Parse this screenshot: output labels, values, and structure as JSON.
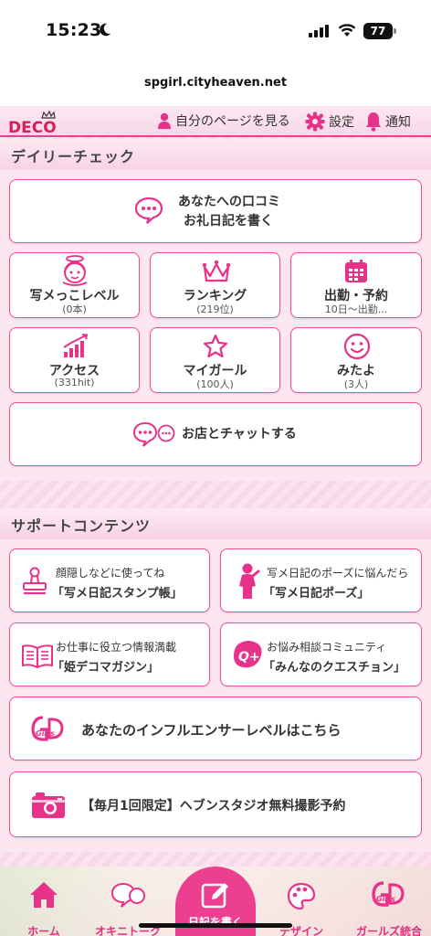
{
  "status_bar": {
    "time": "15:23",
    "battery": "77"
  },
  "browser": {
    "url": "spgirl.cityheaven.net"
  },
  "header": {
    "logo": "DECO",
    "my_page_label": "自分のページを見る",
    "settings_label": "設定",
    "notifications_label": "通知"
  },
  "daily_check": {
    "title": "デイリーチェック",
    "review_line1": "あなたへの口コミ",
    "review_line2": "お礼日記を書く",
    "tiles": [
      {
        "label": "写メっこレベル",
        "sub": "(0本)",
        "icon": "angel-face-icon"
      },
      {
        "label": "ランキング",
        "sub": "(219位)",
        "icon": "crown-icon"
      },
      {
        "label": "出勤・予約",
        "sub": "10日～出勤...",
        "icon": "calendar-icon"
      },
      {
        "label": "アクセス",
        "sub": "(331hit)",
        "icon": "bar-chart-icon"
      },
      {
        "label": "マイガール",
        "sub": "(100人)",
        "icon": "star-icon"
      },
      {
        "label": "みたよ",
        "sub": "(3人)",
        "icon": "smile-icon"
      }
    ],
    "chat_label": "お店とチャットする"
  },
  "support": {
    "title": "サポートコンテンツ",
    "items": [
      {
        "small": "顔隠しなどに使ってね",
        "big": "「写メ日記スタンプ帳」",
        "icon": "stamp-icon"
      },
      {
        "small": "写メ日記のポーズに悩んだら",
        "big": "「写メ日記ポーズ」",
        "icon": "pose-silhouette-icon"
      },
      {
        "small": "お仕事に役立つ情報満載",
        "big": "「姫デコマガジン」",
        "icon": "open-book-icon"
      },
      {
        "small": "お悩み相談コミュニティ",
        "big": "「みんなのクエスチョン」",
        "icon": "question-community-icon"
      }
    ],
    "influencer_label": "あなたのインフルエンサーレベルはこちら",
    "studio_label": "【毎月1回限定】ヘブンスタジオ無料撮影予約"
  },
  "tabbar": {
    "items": [
      {
        "label": "ホーム",
        "icon": "home-icon"
      },
      {
        "label": "オキニトーク",
        "icon": "chat-bubbles-icon"
      },
      {
        "label": "日記を書く",
        "icon": "edit-icon"
      },
      {
        "label": "デザイン",
        "icon": "palette-icon"
      },
      {
        "label": "ガールズ統合",
        "icon": "gd-girls-icon"
      }
    ]
  },
  "colors": {
    "accent": "#e8328a",
    "border": "#ea4f97",
    "panel": "#fce6f0"
  }
}
